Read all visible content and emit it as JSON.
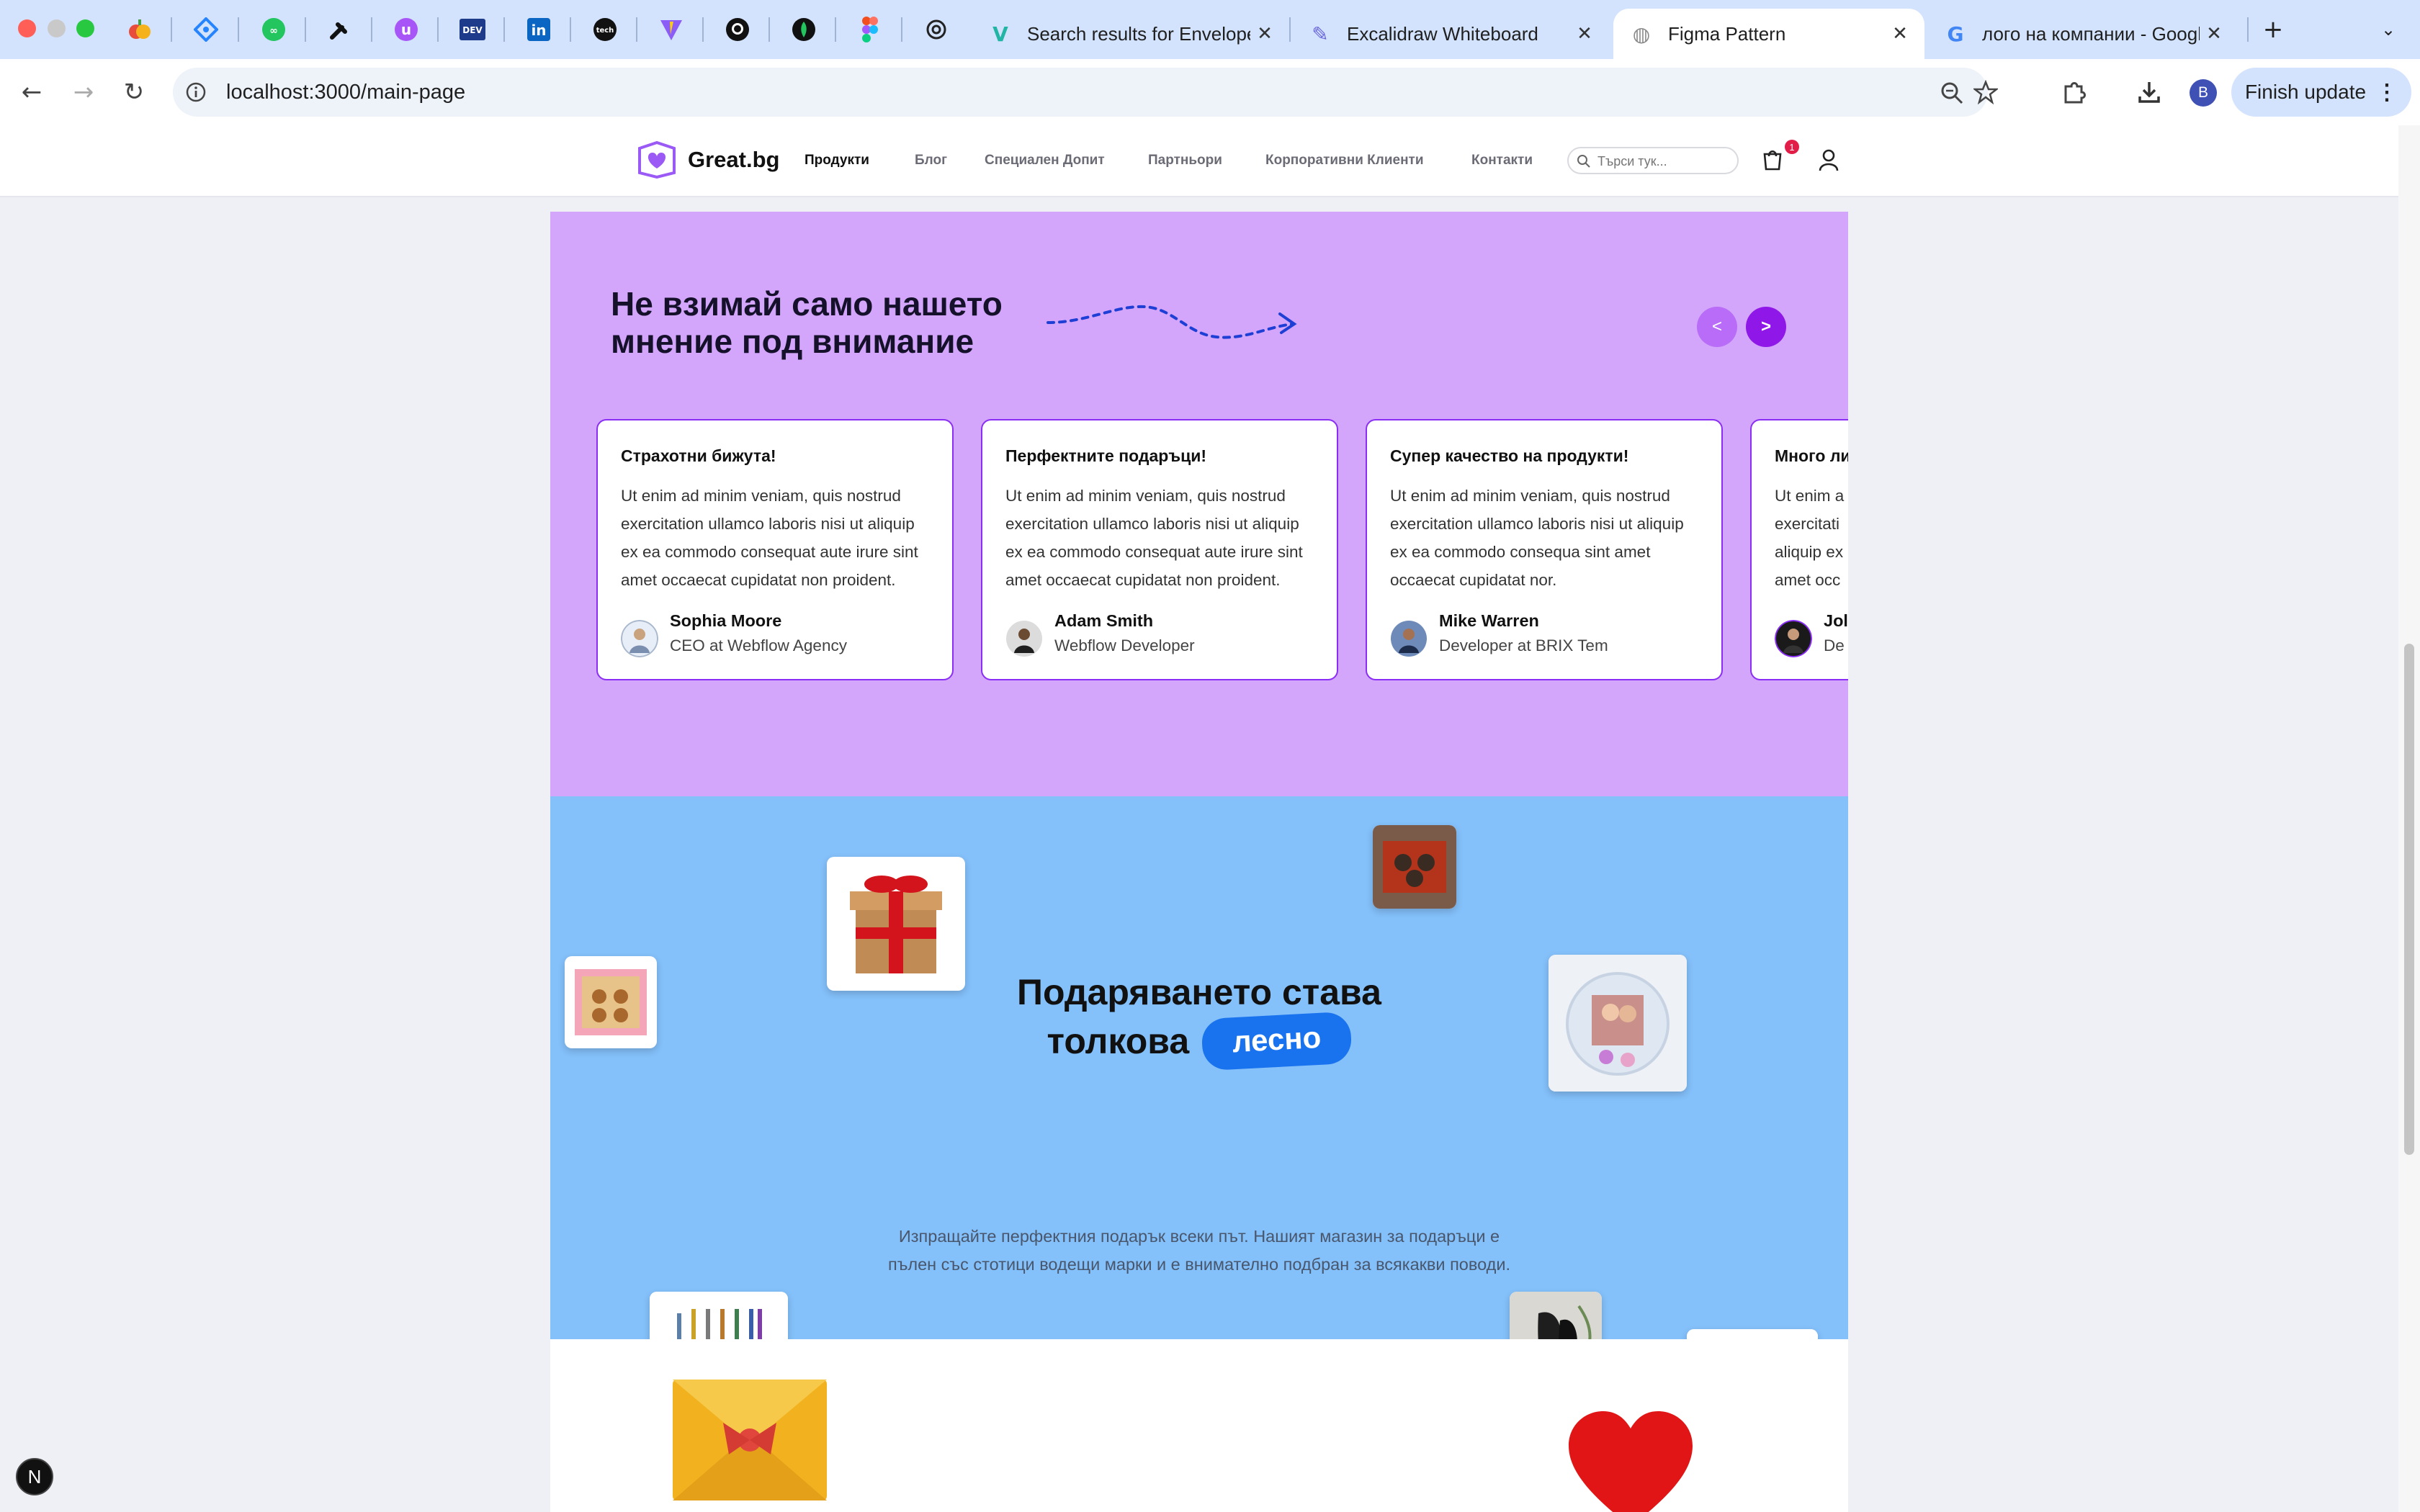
{
  "browser": {
    "tabs": [
      {
        "title": "Search results for Envelope",
        "icon": "V"
      },
      {
        "title": "Excalidraw Whiteboard",
        "icon": "✎"
      },
      {
        "title": "Figma Pattern",
        "icon": "◍"
      },
      {
        "title": "лого на компании - Google",
        "icon": "G"
      }
    ],
    "pinned_icons": [
      "apple-icon",
      "jira-icon",
      "leetcode-icon",
      "codepen-icon",
      "u-icon",
      "dev-icon",
      "linkedin-icon",
      "tech-icon",
      "vite-icon",
      "github-icon",
      "mongodb-icon",
      "figma-icon",
      "openai-icon"
    ],
    "dev_label": "DEV",
    "linkedin_label": "in",
    "tech_label": "tech",
    "url": "localhost:3000/main-page",
    "new_tab": "+",
    "profile_initial": "B",
    "finish_update": "Finish update"
  },
  "nav": {
    "logo": "Great.bg",
    "links": [
      "Продукти",
      "Блог",
      "Специален Допит",
      "Партньори",
      "Корпоративни Клиенти",
      "Контакти"
    ],
    "search_placeholder": "Търси тук...",
    "cart_count": "1"
  },
  "testimonials": {
    "heading_line1": "Не взимай само нашето",
    "heading_line2": "мнение под внимание",
    "prev_label": "<",
    "next_label": ">",
    "cards": [
      {
        "title": "Страхотни бижута!",
        "text": "Ut enim ad minim veniam, quis nostrud exercitation ullamco laboris nisi ut aliquip ex ea commodo consequat aute irure sint amet occaecat cupidatat non proident.",
        "name": "Sophia Moore",
        "role": "CEO at Webflow Agency"
      },
      {
        "title": "Перфектните подаръци!",
        "text": "Ut enim ad minim veniam, quis nostrud exercitation ullamco laboris nisi ut aliquip ex ea commodo consequat aute irure sint amet occaecat cupidatat non proident.",
        "name": "Adam Smith",
        "role": "Webflow Developer"
      },
      {
        "title": "Супер качество на продукти!",
        "text": "Ut enim ad minim veniam, quis nostrud exercitation ullamco laboris nisi ut aliquip ex ea commodo consequa sint amet occaecat cupidatat nor.",
        "name": "Mike Warren",
        "role": "Developer at BRIX Tem"
      },
      {
        "title": "Много ли",
        "text": "Ut enim a exercitati aliquip ex amet occ",
        "name": "Jol",
        "role": "De"
      }
    ]
  },
  "gifting": {
    "heading_line1": "Подаряването става",
    "heading_line2": "толкова",
    "highlight": "лесно",
    "description_line1": "Изпращайте перфектния подарък всеки път. Нашият магазин за подаръци е",
    "description_line2": "пълен със стотици водещи марки и е внимателно подбран за всякакви поводи."
  },
  "dev_badge": "N"
}
